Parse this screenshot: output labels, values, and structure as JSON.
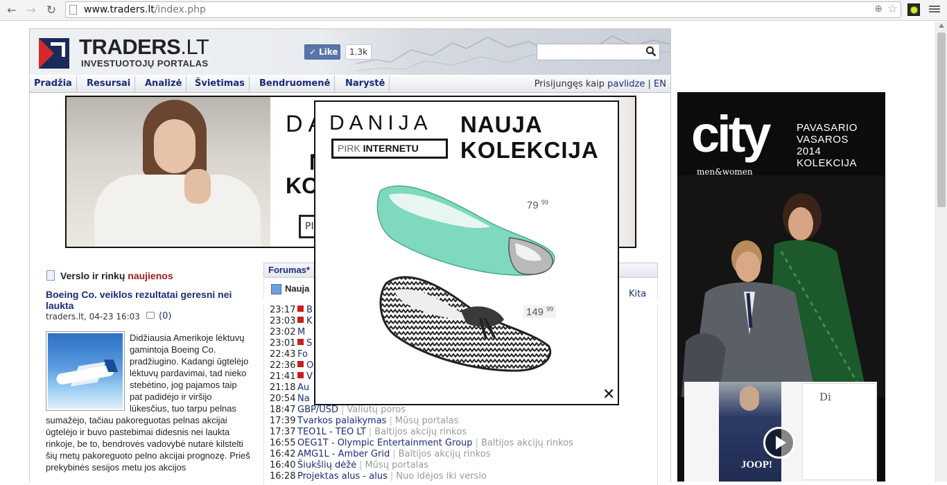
{
  "browser": {
    "url_host": "www.traders.lt",
    "url_path": "/index.php"
  },
  "site": {
    "logo_name": "TRADERS",
    "logo_tld": ".LT",
    "logo_subtitle": "INVESTUOTOJŲ PORTALAS",
    "fb_like_label": "Like",
    "fb_like_count": "1.3k",
    "search_placeholder": ""
  },
  "nav": {
    "items": [
      {
        "label": "Pradžia"
      },
      {
        "label": "Resursai"
      },
      {
        "label": "Analizė"
      },
      {
        "label": "Švietimas"
      },
      {
        "label": "Bendruomenė"
      },
      {
        "label": "Narystė"
      }
    ],
    "logged_in_prefix": "Prisijungęs kaip",
    "username": "pavlidze",
    "separator": "|",
    "language": "EN"
  },
  "banner": {
    "brand": "DA",
    "line2": "N",
    "line3": "KO",
    "button": "PI"
  },
  "news": {
    "heading_prefix": "Verslo ir rinkų",
    "heading_highlight": "naujienos",
    "article_title": "Boeing Co. veiklos rezultatai geresni nei laukta",
    "article_meta": "traders.lt, 04-23 16:03",
    "comment_count": "(0)",
    "article_body": "Didžiausia Amerikoje lėktuvų gamintoja Boeing Co. pradžiugino. Kadangi ūgtelėjo lėktuvų pardavimai, tad nieko stebėtino, jog pajamos taip pat padidėjo ir viršijo lūkesčius, tuo tarpu pelnas sumažėjo, tačiau pakoreguotas pelnas akcijai ūgtelėjo ir buvo pastebimai didesnis nei laukta rinkoje, be to, bendrovės vadovybė nutarė kilstelti šių metų pakoreguoto pelno akcijai prognozę. Prieš prekybinės sesijos metu jos akcijos"
  },
  "forum": {
    "tab_label": "Forumas*",
    "sub_title": "Nauja",
    "kita_label": "Kita",
    "rows": [
      {
        "time": "23:17",
        "new": true,
        "name": "B",
        "category": ""
      },
      {
        "time": "23:03",
        "new": true,
        "name": "K",
        "category": ""
      },
      {
        "time": "23:02",
        "new": false,
        "name": "M",
        "category": ""
      },
      {
        "time": "23:01",
        "new": true,
        "name": "S",
        "category": ""
      },
      {
        "time": "22:43",
        "new": false,
        "name": "Fo",
        "category": ""
      },
      {
        "time": "22:36",
        "new": true,
        "name": "O",
        "category": ""
      },
      {
        "time": "21:41",
        "new": true,
        "name": "V",
        "category": ""
      },
      {
        "time": "21:18",
        "new": false,
        "name": "Au",
        "category": ""
      },
      {
        "time": "20:54",
        "new": false,
        "name": "Na",
        "category": ""
      },
      {
        "time": "18:47",
        "new": false,
        "name": "GBP/USD",
        "category": "Valiutų poros"
      },
      {
        "time": "17:39",
        "new": false,
        "name": "Tvarkos palaikymas",
        "category": "Mūsų portalas"
      },
      {
        "time": "17:37",
        "new": false,
        "name": "TEO1L - TEO LT",
        "category": "Baltijos akcijų rinkos"
      },
      {
        "time": "16:55",
        "new": false,
        "name": "OEG1T - Olympic Entertainment Group",
        "category": "Baltijos akcijų rinkos"
      },
      {
        "time": "16:42",
        "new": false,
        "name": "AMG1L - Amber Grid",
        "category": "Baltijos akcijų rinkos"
      },
      {
        "time": "16:40",
        "new": false,
        "name": "Šiukšlių dėžė",
        "category": "Mūsų portalas"
      },
      {
        "time": "16:28",
        "new": false,
        "name": "Projektas alus - alus",
        "category": "Nuo idėjos iki verslo"
      }
    ]
  },
  "popup_ad": {
    "brand": "DANIJA",
    "button_prefix": "PIRK",
    "button_bold": "INTERNETU",
    "headline1": "NAUJA",
    "headline2": "KOLEKCIJA",
    "price1": "79",
    "price1_cents": "99",
    "price2": "149",
    "price2_cents": "99",
    "close": "✕"
  },
  "side_ad": {
    "brand": "city",
    "tagline": "men&women",
    "season1": "PAVASARIO",
    "season2": "VASAROS",
    "season3": "2014",
    "season4": "KOLEKCIJA",
    "video_brand": "JOOP!",
    "card_label": "Di"
  }
}
